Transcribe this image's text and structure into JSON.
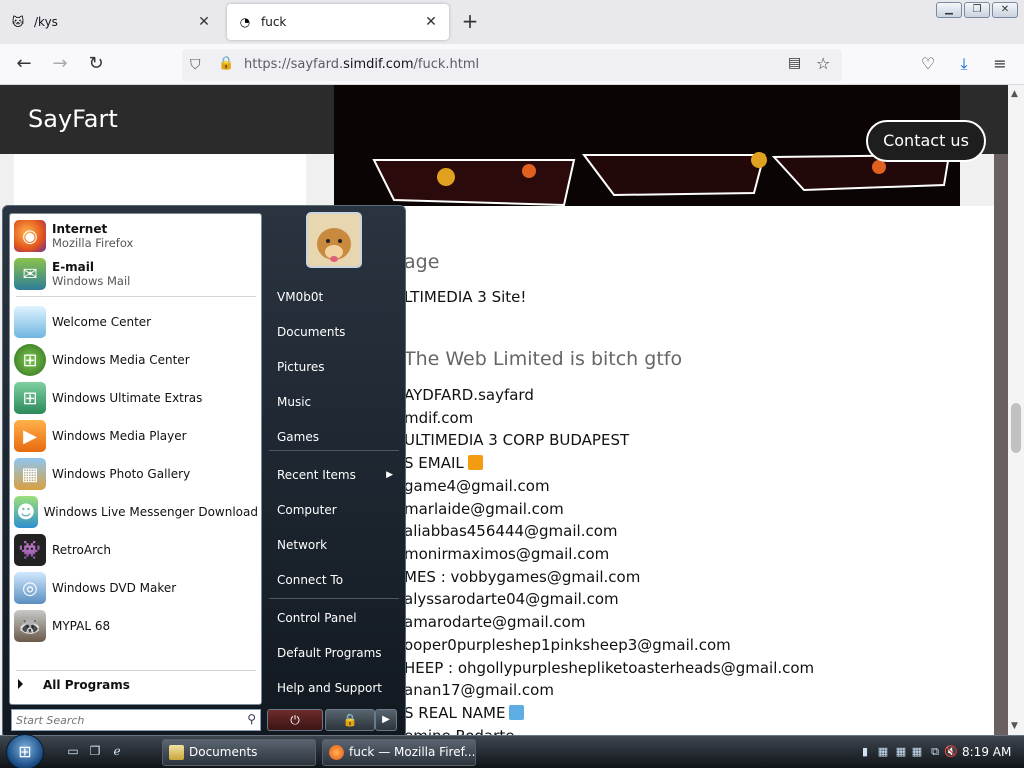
{
  "browser": {
    "tabs": [
      {
        "title": "/kys",
        "active": false
      },
      {
        "title": "fuck",
        "active": true
      }
    ],
    "url": {
      "prefix": "https://sayfard.",
      "domain": "simdif.com",
      "path": "/fuck.html"
    }
  },
  "site": {
    "brand": "SayFart",
    "contact_label": "Contact us",
    "headings": [
      "age",
      "The Web Limited is bitch gtfo"
    ],
    "intro": "LTIMEDIA 3 Site!",
    "lines": [
      "AYDFARD.sayfard",
      "mdif.com",
      "ULTIMEDIA 3 CORP BUDAPEST",
      "S EMAIL",
      "game4@gmail.com",
      "marlaide@gmail.com",
      "aliabbas456444@gmail.com",
      " monirmaximos@gmail.com",
      "MES : vobbygames@gmail.com",
      " alyssarodarte04@gmail.com",
      "amarodarte@gmail.com",
      "ooper0purpleshep1pinksheep3@gmail.com",
      "HEEP : ohgollypurpleshepliketoasterheads@gmail.com",
      "anan17@gmail.com",
      "S REAL NAME",
      "emine Rodarte"
    ],
    "square_colors": {
      "email": "#f39c12",
      "name": "#5dade2"
    }
  },
  "start_menu": {
    "pinned": [
      {
        "title": "Internet",
        "subtitle": "Mozilla Firefox",
        "icon": "firefox-icon"
      },
      {
        "title": "E-mail",
        "subtitle": "Windows Mail",
        "icon": "mail-icon"
      }
    ],
    "recent": [
      {
        "label": "Welcome Center",
        "icon": "welcome-center-icon"
      },
      {
        "label": "Windows Media Center",
        "icon": "media-center-icon"
      },
      {
        "label": "Windows Ultimate Extras",
        "icon": "ultimate-extras-icon"
      },
      {
        "label": "Windows Media Player",
        "icon": "media-player-icon"
      },
      {
        "label": "Windows Photo Gallery",
        "icon": "photo-gallery-icon"
      },
      {
        "label": "Windows Live Messenger Download",
        "icon": "messenger-icon"
      },
      {
        "label": "RetroArch",
        "icon": "retroarch-icon"
      },
      {
        "label": "Windows DVD Maker",
        "icon": "dvd-maker-icon"
      },
      {
        "label": "MYPAL 68",
        "icon": "mypal-icon"
      }
    ],
    "all_programs": "All Programs",
    "search_placeholder": "Start Search",
    "right": [
      "VM0b0t",
      "Documents",
      "Pictures",
      "Music",
      "Games",
      "Recent Items",
      "Computer",
      "Network",
      "Connect To",
      "Control Panel",
      "Default Programs",
      "Help and Support"
    ]
  },
  "taskbar": {
    "buttons": [
      {
        "label": "Documents"
      },
      {
        "label": "fuck — Mozilla Firef..."
      }
    ],
    "clock": "8:19 AM"
  }
}
